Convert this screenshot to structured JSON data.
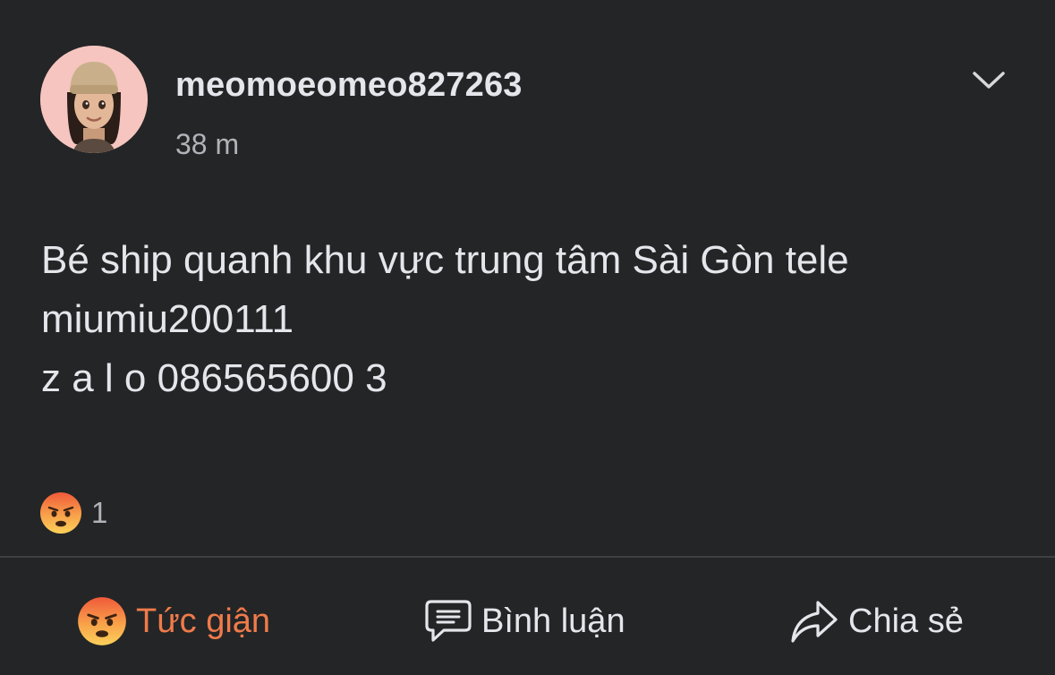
{
  "post": {
    "author": "meomoeomeo827263",
    "time": "38 m",
    "text_lines": [
      "Bé ship quanh khu vực trung tâm Sài Gòn tele",
      "miumiu200111",
      "z a l o 086565600 3"
    ]
  },
  "reactions": {
    "icon": "angry-emoji-icon",
    "count": "1"
  },
  "actions": {
    "react_label": "Tức giận",
    "comment_label": "Bình luận",
    "share_label": "Chia sẻ"
  },
  "colors": {
    "background": "#242526",
    "text": "#e4e6eb",
    "muted": "#b0b3b8",
    "angry_accent": "#f07b4a"
  }
}
